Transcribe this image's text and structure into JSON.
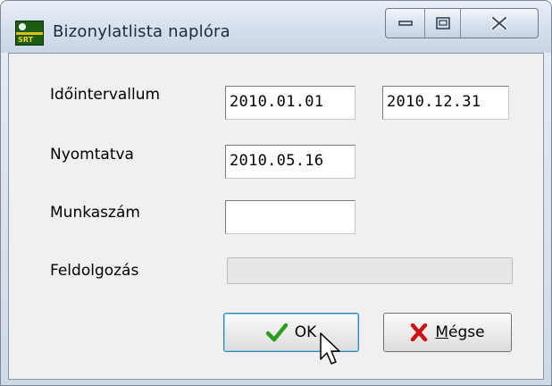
{
  "window": {
    "title": "Bizonylatlista naplóra",
    "icon_label": "SRT"
  },
  "form": {
    "interval_label": "Időintervallum",
    "interval_from": "2010.01.01",
    "interval_to": "2010.12.31",
    "printed_label": "Nyomtatva",
    "printed_value": "2010.05.16",
    "worknumber_label": "Munkaszám",
    "worknumber_value": "",
    "processing_label": "Feldolgozás",
    "processing_progress": 0
  },
  "buttons": {
    "ok_label": "OK",
    "cancel_label_prefix": "M",
    "cancel_label_rest": "égse"
  },
  "colors": {
    "ok_check": "#2e9a1e",
    "cancel_x": "#c81414"
  },
  "icons": {
    "ok": "checkmark-icon",
    "cancel": "red-x-icon",
    "minimize": "minimize-icon",
    "maximize": "maximize-icon",
    "close": "close-icon",
    "pointer": "mouse-pointer-icon"
  }
}
